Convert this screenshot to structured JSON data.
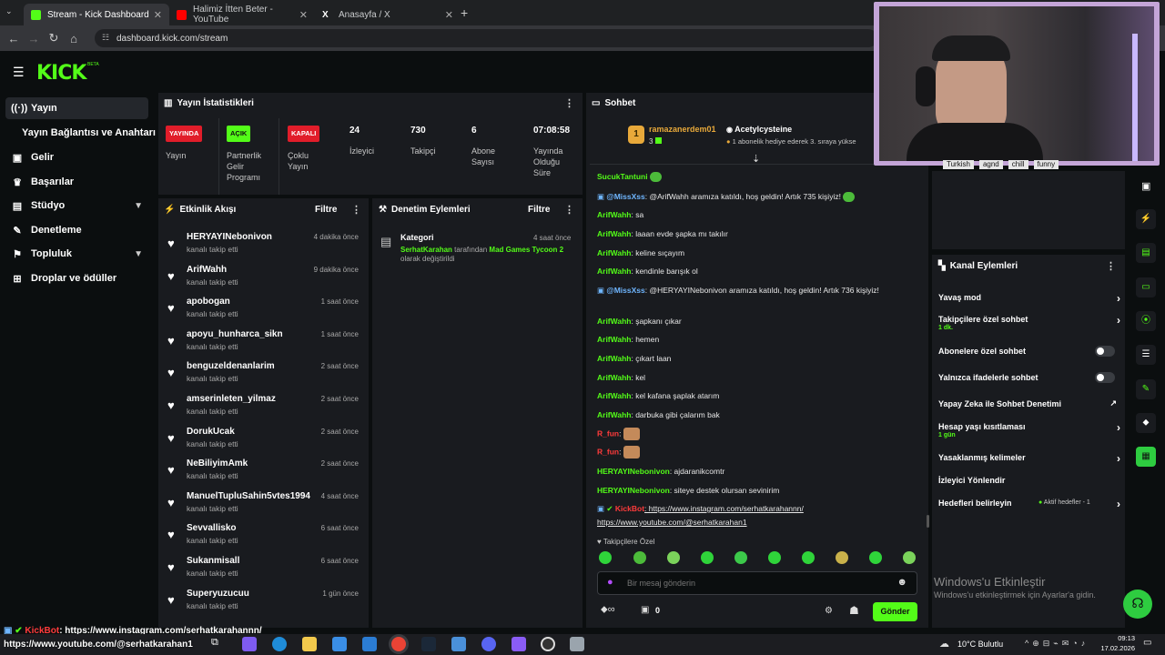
{
  "browser": {
    "tabs": [
      {
        "title": "Stream - Kick Dashboard",
        "color": "#53fc18"
      },
      {
        "title": "Halimiz İtten Beter - YouTube",
        "color": "#ff0000"
      },
      {
        "title": "Anasayfa / X",
        "color": "#ffffff"
      }
    ],
    "url": "dashboard.kick.com/stream"
  },
  "header": {
    "logo": "KICK",
    "beta": "BETA"
  },
  "sidebar": {
    "items": [
      {
        "label": "Yayın",
        "icon": "broadcast-icon"
      },
      {
        "label": "Yayın Bağlantısı ve Anahtarı"
      },
      {
        "label": "Gelir",
        "icon": "revenue-icon"
      },
      {
        "label": "Başarılar",
        "icon": "trophy-icon"
      },
      {
        "label": "Stüdyo",
        "icon": "studio-icon"
      },
      {
        "label": "Denetleme",
        "icon": "moderation-icon"
      },
      {
        "label": "Topluluk",
        "icon": "community-icon"
      },
      {
        "label": "Droplar ve ödüller",
        "icon": "drops-icon"
      }
    ]
  },
  "stats": {
    "title": "Yayın İstatistikleri",
    "items": [
      {
        "badge": "YAYINDA",
        "badge_color": "#e11d2a",
        "label": "Yayın"
      },
      {
        "badge": "AÇIK",
        "badge_color": "#53fc18",
        "label": "Partnerlik Gelir Programı"
      },
      {
        "badge": "KAPALI",
        "badge_color": "#e11d2a",
        "label": "Çoklu Yayın"
      },
      {
        "value": "24",
        "label": "İzleyici"
      },
      {
        "value": "730",
        "label": "Takipçi"
      },
      {
        "value": "6",
        "label": "Abone Sayısı"
      },
      {
        "value": "07:08:58",
        "label": "Yayında Olduğu Süre"
      }
    ]
  },
  "activity": {
    "title": "Etkinlik Akışı",
    "filter": "Filtre",
    "items": [
      {
        "name": "HERYAYINebonivon",
        "sub": "kanalı takip etti",
        "time": "4 dakika önce"
      },
      {
        "name": "ArifWahh",
        "sub": "kanalı takip etti",
        "time": "9 dakika önce"
      },
      {
        "name": "apobogan",
        "sub": "kanalı takip etti",
        "time": "1 saat önce"
      },
      {
        "name": "apoyu_hunharca_sikn",
        "sub": "kanalı takip etti",
        "time": "1 saat önce"
      },
      {
        "name": "benguzeldenanlarim",
        "sub": "kanalı takip etti",
        "time": "2 saat önce"
      },
      {
        "name": "amserinleten_yilmaz",
        "sub": "kanalı takip etti",
        "time": "2 saat önce"
      },
      {
        "name": "DorukUcak",
        "sub": "kanalı takip etti",
        "time": "2 saat önce"
      },
      {
        "name": "NeBiliyimAmk",
        "sub": "kanalı takip etti",
        "time": "2 saat önce"
      },
      {
        "name": "ManuelTupluSahin5vtes1994",
        "sub": "kanalı takip etti",
        "time": "4 saat önce"
      },
      {
        "name": "Sevvallisko",
        "sub": "kanalı takip etti",
        "time": "6 saat önce"
      },
      {
        "name": "Sukanmisall",
        "sub": "kanalı takip etti",
        "time": "6 saat önce"
      },
      {
        "name": "Superyuzucuu",
        "sub": "kanalı takip etti",
        "time": "1 gün önce"
      }
    ]
  },
  "moderation": {
    "title": "Denetim Eylemleri",
    "filter": "Filtre",
    "item": {
      "title": "Kategori",
      "time": "4 saat önce",
      "user": "SerhatKarahan",
      "mid": " tarafından ",
      "game": "Mad Games Tycoon 2",
      "end": "olarak değiştirildi"
    }
  },
  "chat": {
    "title": "Sohbet",
    "pinned": {
      "rank": "1",
      "user": "ramazanerdem01",
      "count": "3",
      "gifter": "Acetylcysteine",
      "gift_text": "1 abonelik hediye ederek 3. sıraya yükse"
    },
    "messages": [
      {
        "user": "SucukTantuni",
        "text": "",
        "color": "#53fc18"
      },
      {
        "user": "@MissXss",
        "text": ": @ArifWahh aramıza katıldı, hoş geldin! Artık 735 kişiyiz!",
        "color": "#6fb6ff"
      },
      {
        "user": "ArifWahh",
        "text": ": sa",
        "color": "#53fc18"
      },
      {
        "user": "ArifWahh",
        "text": ": laaan evde şapka mı takılır",
        "color": "#53fc18"
      },
      {
        "user": "ArifWahh",
        "text": ": keline sıçayım",
        "color": "#53fc18"
      },
      {
        "user": "ArifWahh",
        "text": ": kendinle barışık ol",
        "color": "#53fc18"
      },
      {
        "user": "@MissXss",
        "text": ": @HERYAYINebonivon aramıza katıldı, hoş geldin! Artık 736 kişiyiz!",
        "color": "#6fb6ff"
      },
      {
        "user": "ArifWahh",
        "text": ": şapkanı çıkar",
        "color": "#53fc18"
      },
      {
        "user": "ArifWahh",
        "text": ": hemen",
        "color": "#53fc18"
      },
      {
        "user": "ArifWahh",
        "text": ": çıkart laan",
        "color": "#53fc18"
      },
      {
        "user": "ArifWahh",
        "text": ": kel",
        "color": "#53fc18"
      },
      {
        "user": "ArifWahh",
        "text": ": kel kafana şaplak atarım",
        "color": "#53fc18"
      },
      {
        "user": "ArifWahh",
        "text": ": darbuka gibi çalarım bak",
        "color": "#53fc18"
      },
      {
        "user": "R_fun",
        "text": ":",
        "color": "#ff3b3b"
      },
      {
        "user": "R_fun",
        "text": ":",
        "color": "#ff3b3b"
      },
      {
        "user": "HERYAYINebonivon",
        "text": ": ajdaranikcomtr",
        "color": "#53fc18"
      },
      {
        "user": "HERYAYINebonivon",
        "text": ": siteye destek olursan sevinirim",
        "color": "#53fc18"
      },
      {
        "user": "KickBot",
        "text": ": https://www.instagram.com/serhatkarahannn/",
        "color": "#ff3b3b"
      },
      {
        "user": "",
        "text": "https://www.youtube.com/@serhatkarahan1",
        "color": "#ffffff"
      }
    ],
    "followers_only": "Takipçilere Özel",
    "input_placeholder": "Bir mesaj gönderin",
    "points": "0",
    "send": "Gönder"
  },
  "webcam_tags": [
    "Turkish",
    "agnd",
    "chill",
    "funny"
  ],
  "channel_actions": {
    "title": "Kanal Eylemleri",
    "items": [
      {
        "label": "Yavaş mod",
        "type": "chev"
      },
      {
        "label": "Takipçilere özel sohbet",
        "sub": "1 dk.",
        "type": "chev"
      },
      {
        "label": "Abonelere özel sohbet",
        "type": "toggle"
      },
      {
        "label": "Yalnızca ifadelerle sohbet",
        "type": "toggle"
      },
      {
        "label": "Yapay Zeka ile Sohbet Denetimi",
        "type": "ext"
      },
      {
        "label": "Hesap yaşı kısıtlaması",
        "sub": "1 gün",
        "type": "chev"
      },
      {
        "label": "Yasaklanmış kelimeler",
        "type": "chev"
      },
      {
        "label": "İzleyici Yönlendir",
        "type": "none"
      },
      {
        "label": "Hedefleri belirleyin",
        "sub": "Aktif hedefler - 1",
        "type": "chev"
      }
    ]
  },
  "watermark": {
    "title": "Windows'u Etkinleştir",
    "sub": "Windows'u etkinleştirmek için Ayarlar'a gidin."
  },
  "overlay": {
    "bot": "KickBot",
    "line1": ": https://www.instagram.com/serhatkarahannn/",
    "line2": "https://www.youtube.com/@serhatkarahan1"
  },
  "taskbar": {
    "weather": "10°C  Bulutlu",
    "time": "09:13",
    "date": "17.02.2026"
  }
}
